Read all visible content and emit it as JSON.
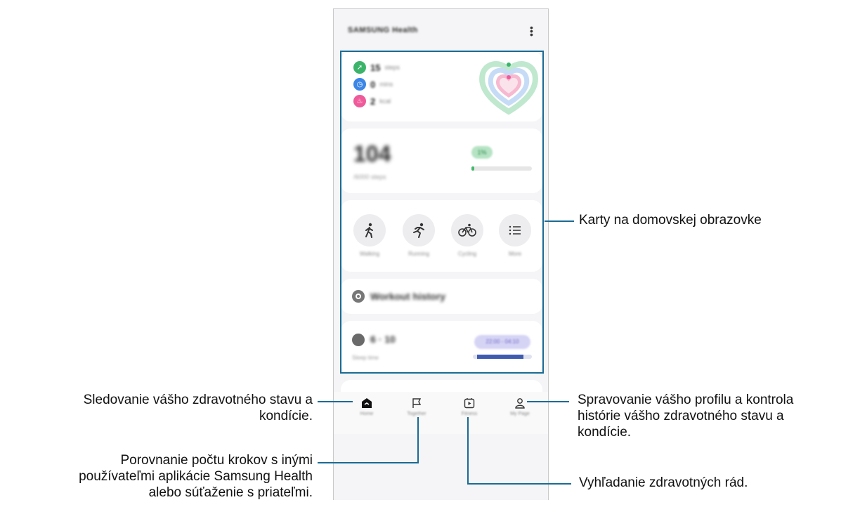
{
  "app": {
    "title": "SAMSUNG Health",
    "menu_icon": "more-vert-icon"
  },
  "activity_card": {
    "stats": [
      {
        "value": "15",
        "unit": "steps",
        "color": "#3bb46a",
        "icon": "shoe-icon"
      },
      {
        "value": "0",
        "unit": "mins",
        "color": "#3b86e6",
        "icon": "clock-icon"
      },
      {
        "value": "2",
        "unit": "kcal",
        "color": "#ef5a9a",
        "icon": "flame-icon"
      }
    ]
  },
  "steps_card": {
    "value": "104",
    "subtitle": "/6000 steps",
    "badge": "1%",
    "progress": 0.02
  },
  "exercise_card": {
    "items": [
      {
        "label": "Walking",
        "icon": "walking-icon"
      },
      {
        "label": "Running",
        "icon": "running-icon"
      },
      {
        "label": "Cycling",
        "icon": "cycling-icon"
      },
      {
        "label": "More",
        "icon": "list-icon"
      }
    ]
  },
  "workout_card": {
    "title": "Workout history"
  },
  "sleep_card": {
    "value": "6 · 10",
    "subtitle": "Sleep time",
    "badge": "22:00 - 04:10"
  },
  "navbar": {
    "items": [
      {
        "label": "Home",
        "icon": "home-icon"
      },
      {
        "label": "Together",
        "icon": "flag-icon"
      },
      {
        "label": "Fitness",
        "icon": "play-video-icon"
      },
      {
        "label": "My Page",
        "icon": "person-icon"
      }
    ]
  },
  "callouts": {
    "cards": "Karty na domovskej obrazovke",
    "home_1": "Sledovanie vášho zdravotného stavu a",
    "home_2": "kondície.",
    "together_1": "Porovnanie počtu krokov s inými",
    "together_2": "používateľmi aplikácie Samsung Health",
    "together_3": "alebo súťaženie s priateľmi.",
    "profile_1": "Spravovanie vášho profilu a kontrola",
    "profile_2": "histórie vášho zdravotného stavu a",
    "profile_3": "kondície.",
    "fitness": "Vyhľadanie zdravotných rád."
  },
  "colors": {
    "accent_line": "#1a6b94"
  }
}
